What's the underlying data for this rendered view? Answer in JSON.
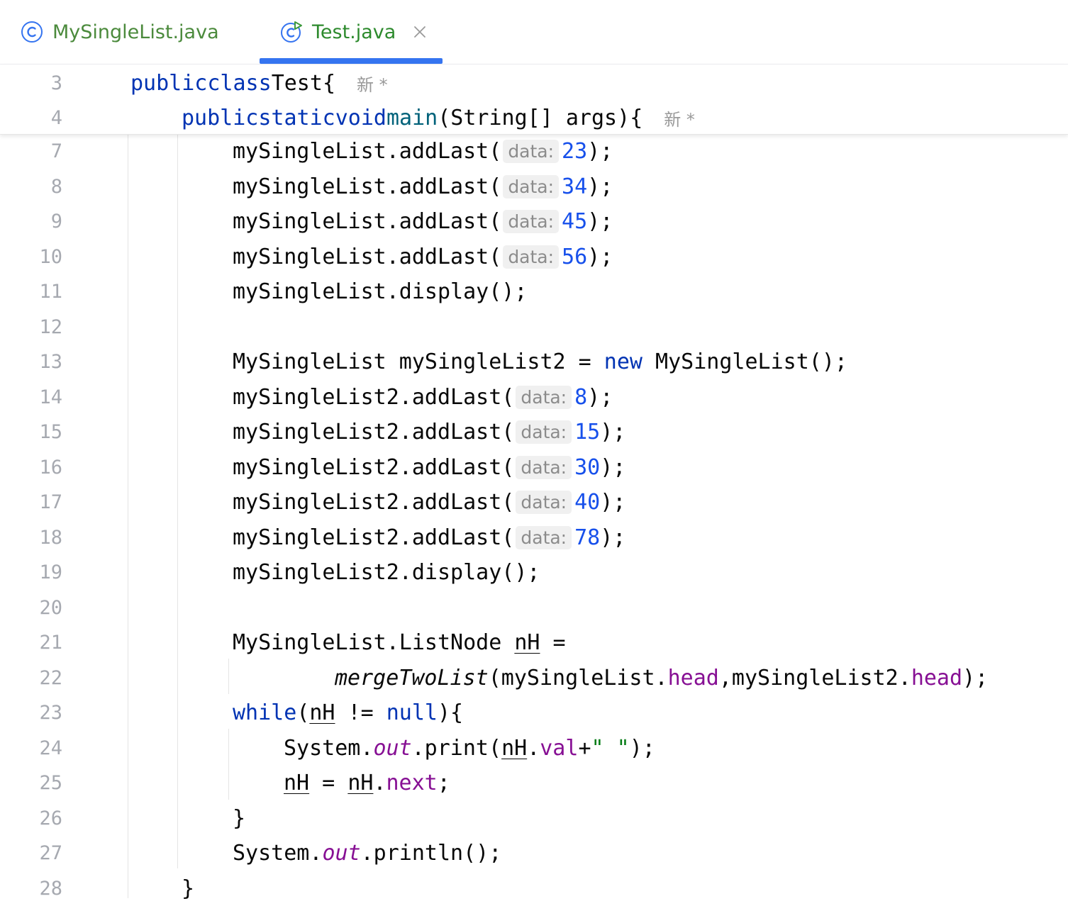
{
  "tabs": [
    {
      "label": "MySingleList.java",
      "icon": "class-icon"
    },
    {
      "label": "Test.java",
      "icon": "runnable-class-icon",
      "active": true
    }
  ],
  "sticky_lines": [
    {
      "num": "3",
      "kw1": "public",
      "kw2": "class",
      "name": "Test",
      "brace": "{",
      "author": "新 *"
    },
    {
      "num": "4",
      "kw1": "public",
      "kw2": "static",
      "kw3": "void",
      "method": "main",
      "params": "(String[] args)",
      "brace": "{",
      "author": "新 *"
    }
  ],
  "hint_label": "data:",
  "code_lines": [
    {
      "num": "7",
      "receiver": "mySingleList",
      "call": ".addLast(",
      "value": "23",
      "end": ");"
    },
    {
      "num": "8",
      "receiver": "mySingleList",
      "call": ".addLast(",
      "value": "34",
      "end": ");"
    },
    {
      "num": "9",
      "receiver": "mySingleList",
      "call": ".addLast(",
      "value": "45",
      "end": ");"
    },
    {
      "num": "10",
      "receiver": "mySingleList",
      "call": ".addLast(",
      "value": "56",
      "end": ");"
    },
    {
      "num": "11",
      "text": "mySingleList.display();"
    },
    {
      "num": "12"
    },
    {
      "num": "13",
      "decl": "MySingleList mySingleList2 = ",
      "kw": "new",
      "rest": " MySingleList();"
    },
    {
      "num": "14",
      "receiver": "mySingleList2",
      "call": ".addLast(",
      "value": "8",
      "end": ");"
    },
    {
      "num": "15",
      "receiver": "mySingleList2",
      "call": ".addLast(",
      "value": "15",
      "end": ");"
    },
    {
      "num": "16",
      "receiver": "mySingleList2",
      "call": ".addLast(",
      "value": "30",
      "end": ");"
    },
    {
      "num": "17",
      "receiver": "mySingleList2",
      "call": ".addLast(",
      "value": "40",
      "end": ");"
    },
    {
      "num": "18",
      "receiver": "mySingleList2",
      "call": ".addLast(",
      "value": "78",
      "end": ");"
    },
    {
      "num": "19",
      "text": "mySingleList2.display();"
    },
    {
      "num": "20"
    },
    {
      "num": "21",
      "type": "MySingleList.ListNode ",
      "var": "nH",
      "eq": " ="
    },
    {
      "num": "22",
      "method": "mergeTwoList",
      "p1": "(mySingleList.",
      "f1": "head",
      "p2": ",mySingleList2.",
      "f2": "head",
      "end": ");"
    },
    {
      "num": "23",
      "kw": "while",
      "open": "(",
      "var": "nH",
      "op": " != ",
      "kw2": "null",
      "close": "){"
    },
    {
      "num": "24",
      "sys": "System.",
      "out": "out",
      "print": ".print(",
      "var": "nH",
      "dot": ".",
      "field": "val",
      "plus": "+",
      "str": "\" \"",
      "end": ");"
    },
    {
      "num": "25",
      "var1": "nH",
      "eq": " = ",
      "var2": "nH",
      "dot": ".",
      "field": "next",
      "end": ";"
    },
    {
      "num": "26",
      "text": "}"
    },
    {
      "num": "27",
      "sys": "System.",
      "out": "out",
      "rest": ".println();"
    },
    {
      "num": "28",
      "text": "}"
    }
  ]
}
